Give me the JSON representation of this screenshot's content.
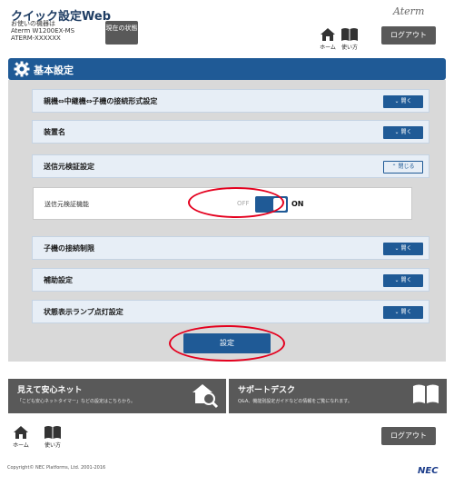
{
  "header": {
    "app_title": "クイック設定Web",
    "device_caption": "お使いの機器は",
    "device_model": "Aterm W1200EX-MS",
    "device_ssid": "ATERM-XXXXXX",
    "status_button": "現在の状態",
    "brand": "Aterm",
    "nav": {
      "home": "ホーム",
      "manual": "使い方"
    },
    "logout": "ログアウト"
  },
  "section": {
    "title": "基本設定"
  },
  "accordion": [
    {
      "label": "親機⇔中継機⇔子機の接続形式設定",
      "button": "開く",
      "state": "closed"
    },
    {
      "label": "装置名",
      "button": "開く",
      "state": "closed"
    },
    {
      "label": "送信元検証設定",
      "button": "閉じる",
      "state": "open"
    },
    {
      "label": "子機の接続制限",
      "button": "開く",
      "state": "closed"
    },
    {
      "label": "補助設定",
      "button": "開く",
      "state": "closed"
    },
    {
      "label": "状態表示ランプ点灯設定",
      "button": "開く",
      "state": "closed"
    }
  ],
  "source_verification": {
    "label": "送信元検証機能",
    "off_label": "OFF",
    "on_label": "ON",
    "value": "ON"
  },
  "apply_button": "設定",
  "promos": [
    {
      "title": "見えて安心ネット",
      "desc": "「こども安心ネットタイマー」などの設定はこちらから。"
    },
    {
      "title": "サポートデスク",
      "desc": "Q&A、機能別設定ガイドなどの情報をご覧になれます。"
    }
  ],
  "footer": {
    "nav": {
      "home": "ホーム",
      "manual": "使い方"
    },
    "logout": "ログアウト",
    "copyright": "Copyright© NEC Platforms, Ltd. 2001-2016",
    "logo": "NEC"
  },
  "colors": {
    "accent": "#1f5a96",
    "panel": "#d9d9d9",
    "highlight": "#e4001e"
  }
}
